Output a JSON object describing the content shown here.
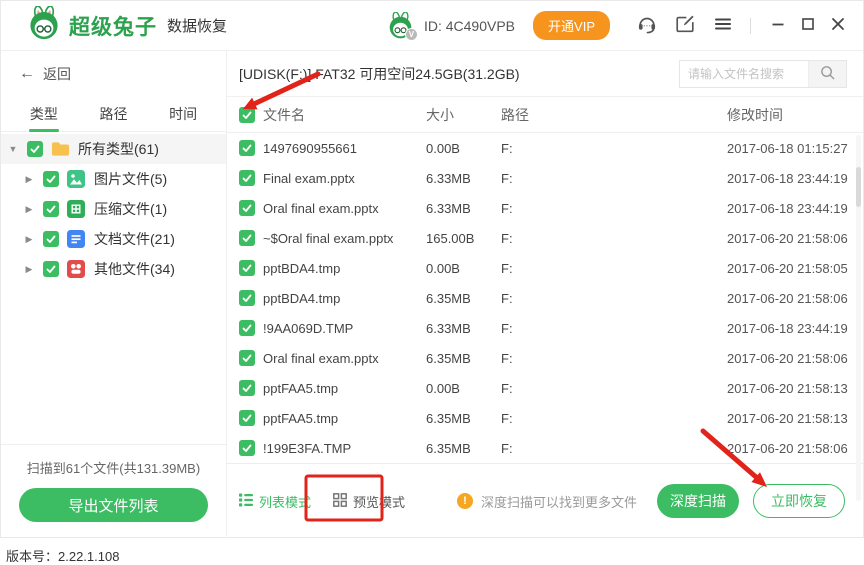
{
  "colors": {
    "green": "#3cbd63",
    "orange": "#f7941e",
    "warning": "#f5a623",
    "annotation_red": "#e2231a"
  },
  "icons": {
    "back": "←",
    "caret_down": "▼",
    "caret_right": "▶",
    "warning": "!",
    "vip_badge": "V"
  },
  "titlebar": {
    "brand_name": "超级兔子",
    "brand_suffix": "数据恢复",
    "user_id": "ID: 4C490VPB",
    "vip_button": "开通VIP"
  },
  "sidebar": {
    "back_label": "返回",
    "tabs": [
      {
        "label": "类型",
        "active": true
      },
      {
        "label": "路径",
        "active": false
      },
      {
        "label": "时间",
        "active": false
      }
    ],
    "tree": [
      {
        "label": "所有类型(61)",
        "icon": "folder-icon",
        "expanded": true,
        "root": true,
        "checked": true
      },
      {
        "label": "图片文件(5)",
        "icon": "image-file-icon",
        "expanded": false,
        "root": false,
        "checked": true
      },
      {
        "label": "压缩文件(1)",
        "icon": "archive-file-icon",
        "expanded": false,
        "root": false,
        "checked": true
      },
      {
        "label": "文档文件(21)",
        "icon": "document-file-icon",
        "expanded": false,
        "root": false,
        "checked": true
      },
      {
        "label": "其他文件(34)",
        "icon": "other-file-icon",
        "expanded": false,
        "root": false,
        "checked": true
      }
    ],
    "scan_summary": "扫描到61个文件(共131.39MB)",
    "export_button": "导出文件列表"
  },
  "main": {
    "disk_info": "[UDISK(F:)] FAT32 可用空间24.5GB(31.2GB)",
    "search_placeholder": "请输入文件名搜索",
    "table": {
      "headers": {
        "name": "文件名",
        "size": "大小",
        "path": "路径",
        "modified": "修改时间"
      },
      "rows": [
        {
          "name": "1497690955661",
          "size": "0.00B",
          "path": "F:",
          "modified": "2017-06-18 01:15:27"
        },
        {
          "name": "Final exam.pptx",
          "size": "6.33MB",
          "path": "F:",
          "modified": "2017-06-18 23:44:19"
        },
        {
          "name": "Oral final exam.pptx",
          "size": "6.33MB",
          "path": "F:",
          "modified": "2017-06-18 23:44:19"
        },
        {
          "name": "~$Oral final exam.pptx",
          "size": "165.00B",
          "path": "F:",
          "modified": "2017-06-20 21:58:06"
        },
        {
          "name": "pptBDA4.tmp",
          "size": "0.00B",
          "path": "F:",
          "modified": "2017-06-20 21:58:05"
        },
        {
          "name": "pptBDA4.tmp",
          "size": "6.35MB",
          "path": "F:",
          "modified": "2017-06-20 21:58:06"
        },
        {
          "name": "!9AA069D.TMP",
          "size": "6.33MB",
          "path": "F:",
          "modified": "2017-06-18 23:44:19"
        },
        {
          "name": "Oral final exam.pptx",
          "size": "6.35MB",
          "path": "F:",
          "modified": "2017-06-20 21:58:06"
        },
        {
          "name": "pptFAA5.tmp",
          "size": "0.00B",
          "path": "F:",
          "modified": "2017-06-20 21:58:13"
        },
        {
          "name": "pptFAA5.tmp",
          "size": "6.35MB",
          "path": "F:",
          "modified": "2017-06-20 21:58:13"
        },
        {
          "name": "!199E3FA.TMP",
          "size": "6.35MB",
          "path": "F:",
          "modified": "2017-06-20 21:58:06"
        }
      ]
    },
    "footer": {
      "list_mode": "列表模式",
      "preview_mode": "预览模式",
      "deep_scan_hint": "深度扫描可以找到更多文件",
      "deep_scan_button": "深度扫描",
      "recover_button": "立即恢复"
    }
  },
  "version": "版本号：2.22.1.108"
}
